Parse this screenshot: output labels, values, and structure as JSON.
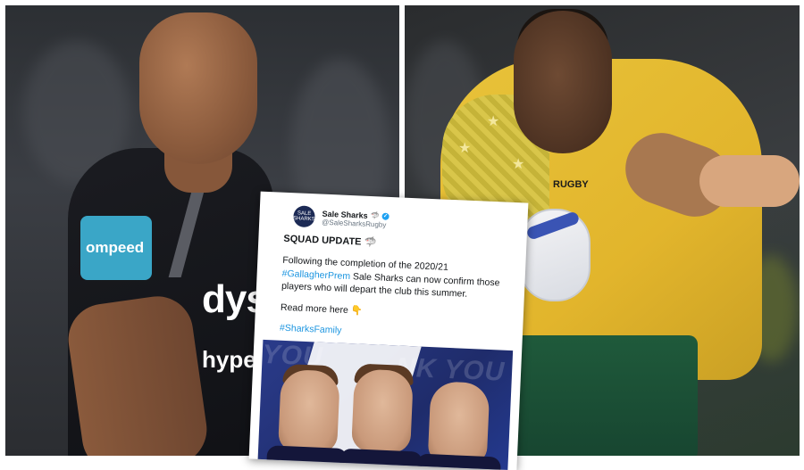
{
  "left_photo": {
    "sleeve_logo": "ompeed",
    "sponsor_main": "dyso",
    "sponsor_sub": "hyperd"
  },
  "right_photo": {
    "jersey_text": "RUGBY"
  },
  "tweet": {
    "account_name": "Sale Sharks",
    "handle": "@SaleSharksRugby",
    "title": "SQUAD UPDATE",
    "line1": "Following the completion of the 2020/21",
    "hashtag1": "#GallagherPrem",
    "line2": " Sale Sharks can now confirm those players who will depart the club this summer.",
    "read_more": "Read more here",
    "hashtag2": "#SharksFamily",
    "media_text_1": "YOU",
    "media_text_2": "NK YOU"
  }
}
